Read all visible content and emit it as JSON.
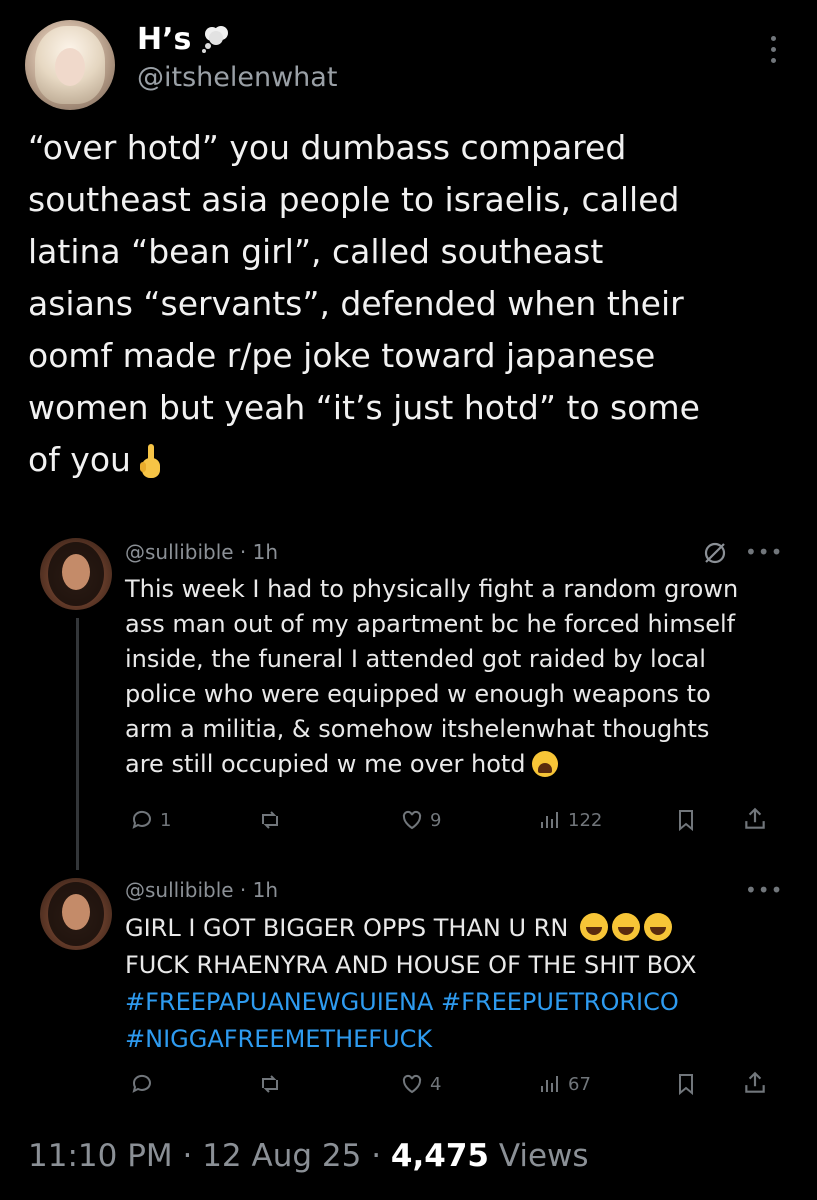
{
  "tweet": {
    "display_name": "H’s",
    "handle": "@itshelenwhat",
    "text": "“over hotd” you dumbass compared\nsoutheast asia people to israelis, called\nlatina “bean girl”, called southeast\nasians “servants”, defended when their\noomf made r/pe joke toward japanese\nwomen but yeah “it’s just hotd” to some\nof you",
    "emoji": "middle-finger-emoji"
  },
  "replies": [
    {
      "handle": "@sullibible · 1h",
      "text": "This week I had to physically fight a random grown\nass man out of my apartment bc he forced himself\ninside, the funeral I attended got raided by local\npolice who were equipped w enough weapons to\narm a militia, & somehow itshelenwhat thoughts\nare still occupied w me over hotd",
      "reply_count": "1",
      "retweet_count": "",
      "like_count": "9",
      "view_count": "122"
    },
    {
      "handle": "@sullibible · 1h",
      "line1": "GIRL I GOT BIGGER OPPS THAN U RN",
      "line2": "FUCK RHAENYRA AND HOUSE OF THE SHIT BOX",
      "hashtag1": "#FREEPAPUANEWGUIENA",
      "hashtag2": "#FREEPUETRORICO",
      "hashtag3": "#NIGGAFREEMETHEFUCK",
      "reply_count": "",
      "retweet_count": "",
      "like_count": "4",
      "view_count": "67"
    }
  ],
  "footer": {
    "time": "11:10 PM",
    "sep1": " · ",
    "date": "12 Aug 25",
    "sep2": " · ",
    "views": "4,475",
    "views_label": " Views"
  },
  "colors": {
    "background": "#000000",
    "hashtag": "#2e9bf0",
    "muted": "#71767b"
  }
}
